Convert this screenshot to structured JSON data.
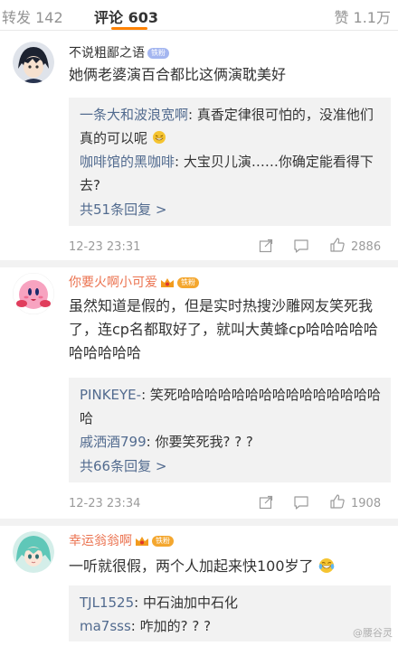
{
  "tabs": {
    "repost": "转发 142",
    "comments": "评论 603",
    "likes": "赞 1.1万"
  },
  "comments": [
    {
      "name": "不说粗鄙之语",
      "badge": "铁粉",
      "text": "她俩老婆演百合都比这俩演耽美好",
      "replies": [
        {
          "who": "一条大和波浪宽啊",
          "text": ": 真香定律很可怕的，没准他们真的可以呢 "
        },
        {
          "who": "咖啡馆的黑咖啡",
          "text": ": 大宝贝儿演……你确定能看得下去?"
        }
      ],
      "more": "共51条回复 >",
      "time": "12-23 23:31",
      "likes": "2886"
    },
    {
      "name": "你要火啊小可爱",
      "badge": "铁粉",
      "text": "虽然知道是假的，但是实时热搜沙雕网友笑死我了，连cp名都取好了，就叫大黄蜂cp哈哈哈哈哈哈哈哈哈哈",
      "replies": [
        {
          "who": "PINKEYE-",
          "text": ": 笑死哈哈哈哈哈哈哈哈哈哈哈哈哈哈哈哈"
        },
        {
          "who": "戚洒酒799",
          "text": ": 你要笑死我? ? ?"
        }
      ],
      "more": "共66条回复 >",
      "time": "12-23 23:34",
      "likes": "1908"
    },
    {
      "name": "幸运翁翁啊",
      "badge": "铁粉",
      "text": "一听就很假，两个人加起来快100岁了",
      "replies": [
        {
          "who": "TJL1525",
          "text": ": 中石油加中石化"
        },
        {
          "who": "ma7sss",
          "text": ": 咋加的? ? ?"
        }
      ]
    }
  ],
  "watermark": "@腰谷灵",
  "colors": {
    "accent": "#ff8200",
    "link": "#526b8f",
    "username": "#eb7350"
  }
}
